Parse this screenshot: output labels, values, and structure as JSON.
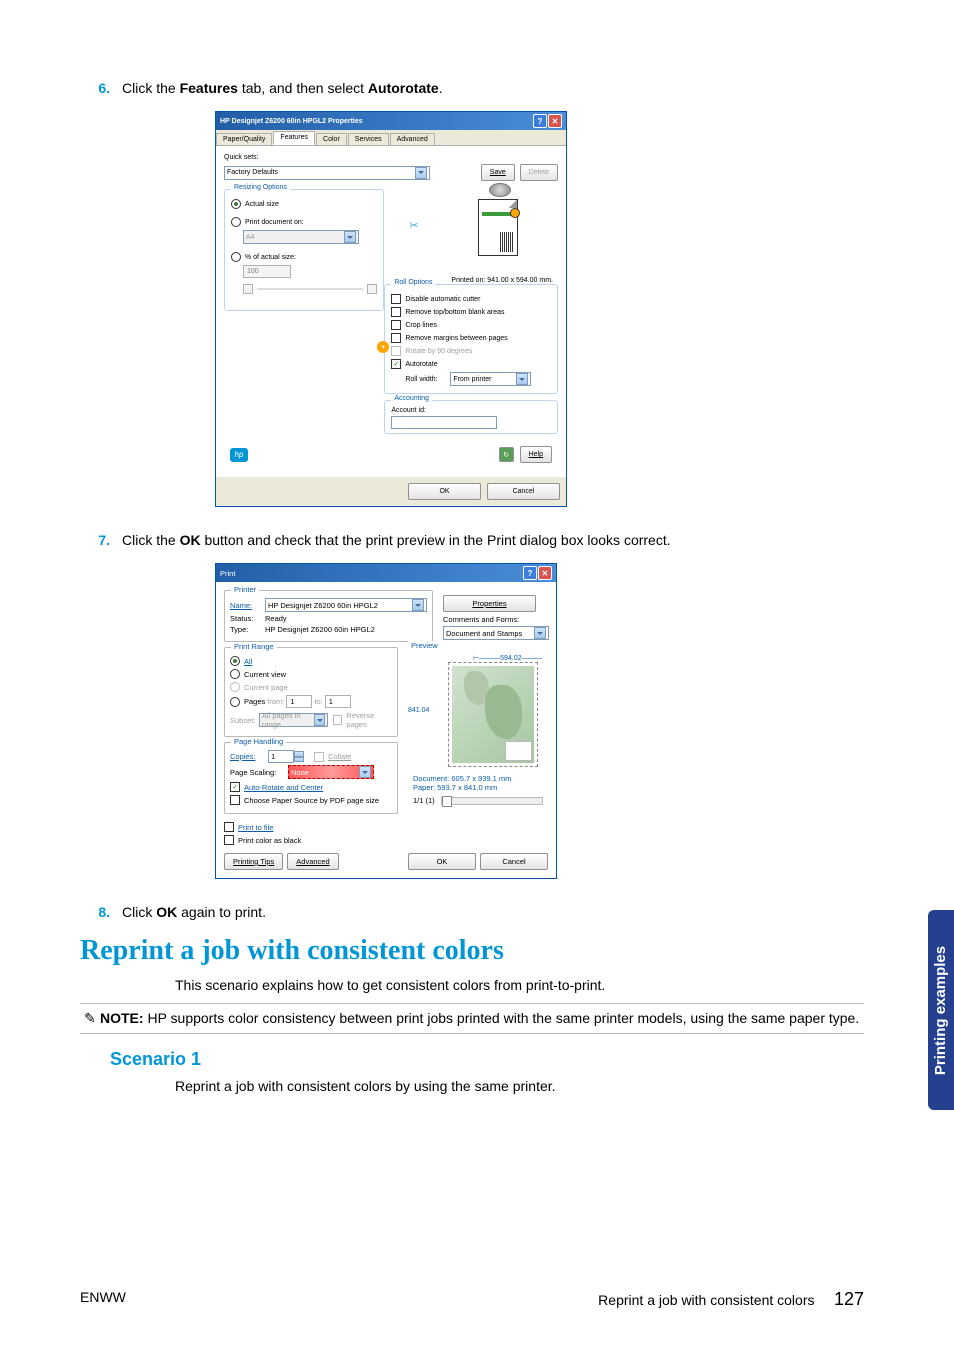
{
  "step6": {
    "num": "6.",
    "text_pre": "Click the ",
    "strong1": "Features",
    "text_mid": " tab, and then select ",
    "strong2": "Autorotate",
    "text_post": "."
  },
  "dialog1": {
    "title": "HP Designjet Z6200 60in HPGL2 Properties",
    "tabs": [
      "Paper/Quality",
      "Features",
      "Color",
      "Services",
      "Advanced"
    ],
    "quicksets_label": "Quick sets:",
    "quicksets_value": "Factory Defaults",
    "save": "Save",
    "delete": "Delete",
    "resizing": {
      "title": "Resizing Options",
      "actual": "Actual size",
      "printon": "Print document on:",
      "printon_value": "A4",
      "pct": "% of actual size:",
      "pct_value": "100"
    },
    "preview_size": "Printed on: 941.00 x 594.00 mm.",
    "roll": {
      "title": "Roll Options",
      "disable_cutter": "Disable automatic cutter",
      "remove_top": "Remove top/bottom blank areas",
      "crop": "Crop lines",
      "remove_margins": "Remove margins between pages",
      "rotate90": "Rotate by 90 degrees",
      "autorotate": "Autorotate",
      "rollwidth_label": "Roll width:",
      "rollwidth_value": "From printer"
    },
    "accounting": {
      "title": "Accounting",
      "label": "Account id:"
    },
    "help": "Help",
    "ok": "OK",
    "cancel": "Cancel"
  },
  "step7": {
    "num": "7.",
    "pre": "Click the ",
    "strong": "OK",
    "post": " button and check that the print preview in the Print dialog box looks correct."
  },
  "dialog2": {
    "title": "Print",
    "printer": {
      "title": "Printer",
      "name_label": "Name:",
      "name_value": "HP Designjet Z6200 60in HPGL2",
      "status_label": "Status:",
      "status_value": "Ready",
      "type_label": "Type:",
      "type_value": "HP Designjet Z6200 60in HPGL2",
      "properties": "Properties",
      "comments_label": "Comments and Forms:",
      "comments_value": "Document and Stamps"
    },
    "range": {
      "title": "Print Range",
      "all": "All",
      "current_view": "Current view",
      "current_page": "Current page",
      "pages": "Pages",
      "from": "from:",
      "from_val": "1",
      "to": "to:",
      "to_val": "1",
      "subset_label": "Subset:",
      "subset_value": "All pages in range",
      "reverse": "Reverse pages"
    },
    "handling": {
      "title": "Page Handling",
      "copies_label": "Copies:",
      "copies_value": "1",
      "collate": "Collate",
      "scaling_label": "Page Scaling:",
      "scaling_value": "None",
      "autorotate": "Auto-Rotate and Center",
      "choose_paper": "Choose Paper Source by PDF page size"
    },
    "preview": {
      "title": "Preview",
      "w": "594.02",
      "h": "841.04",
      "doc": "Document: 605.7 x 939.1 mm",
      "paper": "Paper: 593.7 x 841.0 mm",
      "pages": "1/1 (1)"
    },
    "print_to_file": "Print to file",
    "print_black": "Print color as black",
    "tips": "Printing Tips",
    "advanced": "Advanced",
    "ok": "OK",
    "cancel": "Cancel"
  },
  "step8": {
    "num": "8.",
    "pre": "Click ",
    "strong": "OK",
    "post": " again to print."
  },
  "reprint_heading": "Reprint a job with consistent colors",
  "reprint_intro": "This scenario explains how to get consistent colors from print-to-print.",
  "note": {
    "strong": "NOTE:",
    "text": " HP supports color consistency between print jobs printed with the same printer models, using the same paper type."
  },
  "scenario1_heading": "Scenario 1",
  "scenario1_text": "Reprint a job with consistent colors by using the same printer.",
  "side_tab": "Printing examples",
  "footer": {
    "left": "ENWW",
    "right_text": "Reprint a job with consistent colors",
    "page": "127"
  }
}
